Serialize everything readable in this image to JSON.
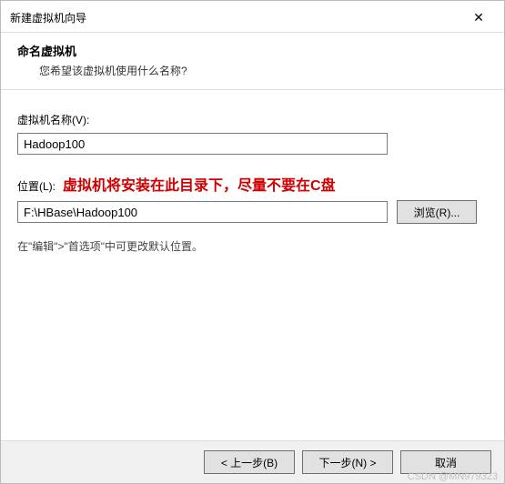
{
  "window": {
    "title": "新建虚拟机向导"
  },
  "header": {
    "title": "命名虚拟机",
    "subtitle": "您希望该虚拟机使用什么名称?"
  },
  "fields": {
    "name_label": "虚拟机名称(V):",
    "name_value": "Hadoop100",
    "location_label": "位置(L):",
    "location_value": "F:\\HBase\\Hadoop100",
    "browse_label": "浏览(R)..."
  },
  "annotation": "虚拟机将安装在此目录下，尽量不要在C盘",
  "note": "在\"编辑\">\"首选项\"中可更改默认位置。",
  "footer": {
    "back": "< 上一步(B)",
    "next": "下一步(N) >",
    "cancel": "取消"
  },
  "watermark": "CSDN @MN979323"
}
